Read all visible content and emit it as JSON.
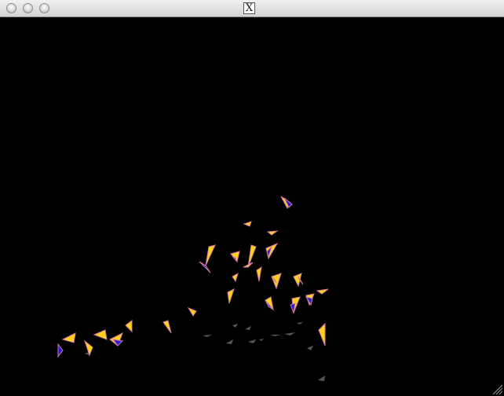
{
  "window": {
    "title_icon_label": "X"
  },
  "colors": {
    "background": "#000000",
    "bird_fill": "#ffd21a",
    "bird_wing": "#2a1fd0",
    "bird_outline": "#d27aa0",
    "shadow": "#555555"
  },
  "icons": {
    "close": "close-button-icon",
    "minimize": "minimize-button-icon",
    "zoom": "zoom-button-icon",
    "title": "x11-icon",
    "resize": "resize-grip-icon"
  }
}
